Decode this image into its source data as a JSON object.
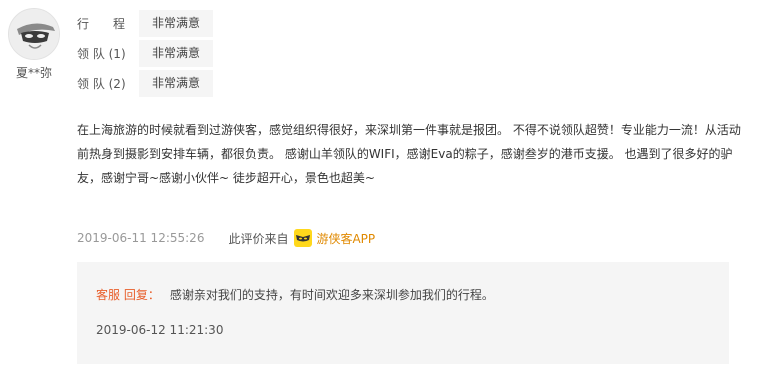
{
  "user": {
    "name": "夏**弥"
  },
  "ratings": [
    {
      "label": "行　　程",
      "value": "非常满意"
    },
    {
      "label": "领 队 (1)",
      "value": "非常满意"
    },
    {
      "label": "领 队 (2)",
      "value": "非常满意"
    }
  ],
  "review": {
    "text": "在上海旅游的时候就看到过游侠客，感觉组织得很好，来深圳第一件事就是报团。 不得不说领队超赞！专业能力一流！从活动前热身到摄影到安排车辆，都很负责。 感谢山羊领队的WIFI，感谢Eva的粽子，感谢叁岁的港币支援。 也遇到了很多好的驴友，感谢宁哥~感谢小伙伴~ 徒步超开心，景色也超美~",
    "date": "2019-06-11 12:55:26",
    "source_label": "此评价来自",
    "source_app": "游侠客APP"
  },
  "reply": {
    "who": "客服 回复：",
    "text": "感谢亲对我们的支持，有时间欢迎多来深圳参加我们的行程。",
    "date": "2019-06-12 11:21:30"
  },
  "icons": {
    "avatar": "mask-avatar",
    "app": "youxiake-app-icon"
  },
  "colors": {
    "app_name": "#e08900",
    "reply_who": "#e85e2a",
    "app_icon_bg": "#ffd81c"
  }
}
